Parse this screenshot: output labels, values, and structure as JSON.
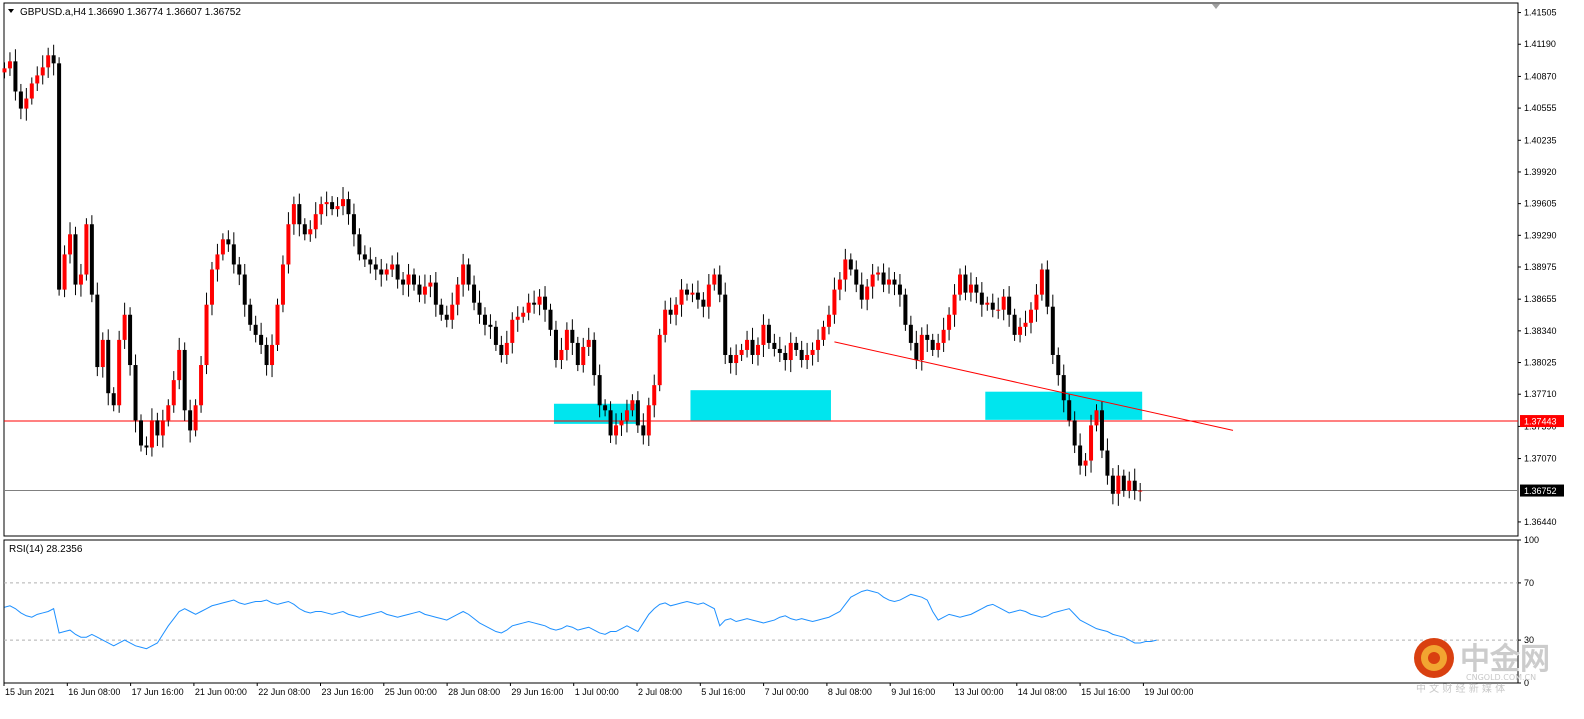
{
  "chart_header": {
    "symbol": "GBPUSD.a,H4",
    "ohlc": "1.36690 1.36774 1.36607 1.36752"
  },
  "chart_data": [
    {
      "type": "candlestick",
      "title": "GBPUSD.a,H4",
      "ylim": [
        1.363,
        1.416
      ],
      "price_ticks": [
        "1.41505",
        "1.41190",
        "1.40870",
        "1.40555",
        "1.40235",
        "1.39920",
        "1.39605",
        "1.39290",
        "1.38975",
        "1.38655",
        "1.38340",
        "1.38025",
        "1.37710",
        "1.37390",
        "1.37070",
        "1.36440"
      ],
      "x_ticks": [
        "15 Jun 2021",
        "16 Jun 08:00",
        "17 Jun 16:00",
        "21 Jun 00:00",
        "22 Jun 08:00",
        "23 Jun 16:00",
        "25 Jun 00:00",
        "28 Jun 08:00",
        "29 Jun 16:00",
        "1 Jul 00:00",
        "2 Jul 08:00",
        "5 Jul 16:00",
        "7 Jul 00:00",
        "8 Jul 08:00",
        "9 Jul 16:00",
        "13 Jul 00:00",
        "14 Jul 08:00",
        "15 Jul 16:00",
        "19 Jul 00:00"
      ],
      "candle_count": 220,
      "closes": [
        1.4095,
        1.4102,
        1.4072,
        1.4055,
        1.4065,
        1.408,
        1.4088,
        1.4096,
        1.4108,
        1.41,
        1.3875,
        1.391,
        1.393,
        1.388,
        1.389,
        1.394,
        1.387,
        1.3798,
        1.3825,
        1.3772,
        1.376,
        1.3825,
        1.385,
        1.38,
        1.3745,
        1.372,
        1.3718,
        1.3745,
        1.373,
        1.3745,
        1.376,
        1.3785,
        1.3815,
        1.3755,
        1.3735,
        1.376,
        1.38,
        1.386,
        1.3895,
        1.391,
        1.3925,
        1.392,
        1.39,
        1.389,
        1.386,
        1.384,
        1.383,
        1.382,
        1.38,
        1.382,
        1.386,
        1.39,
        1.394,
        1.396,
        1.394,
        1.393,
        1.3935,
        1.395,
        1.396,
        1.3962,
        1.3955,
        1.3958,
        1.3965,
        1.395,
        1.393,
        1.391,
        1.3905,
        1.39,
        1.3895,
        1.389,
        1.3895,
        1.39,
        1.3885,
        1.388,
        1.389,
        1.388,
        1.387,
        1.3878,
        1.3882,
        1.386,
        1.385,
        1.3845,
        1.386,
        1.388,
        1.39,
        1.388,
        1.3862,
        1.385,
        1.384,
        1.3838,
        1.382,
        1.381,
        1.3822,
        1.3845,
        1.3848,
        1.3852,
        1.3862,
        1.386,
        1.3868,
        1.3855,
        1.3835,
        1.3805,
        1.3815,
        1.3835,
        1.3822,
        1.38,
        1.3818,
        1.3825,
        1.379,
        1.376,
        1.3755,
        1.373,
        1.374,
        1.3745,
        1.3755,
        1.3765,
        1.374,
        1.373,
        1.376,
        1.378,
        1.383,
        1.3855,
        1.385,
        1.386,
        1.3875,
        1.387,
        1.3872,
        1.3865,
        1.3858,
        1.388,
        1.389,
        1.387,
        1.381,
        1.3802,
        1.381,
        1.3815,
        1.3825,
        1.381,
        1.382,
        1.384,
        1.3822,
        1.3816,
        1.3812,
        1.3805,
        1.3822,
        1.3815,
        1.3805,
        1.381,
        1.3815,
        1.3825,
        1.3838,
        1.385,
        1.3875,
        1.3885,
        1.3905,
        1.3895,
        1.388,
        1.3865,
        1.3878,
        1.389,
        1.3892,
        1.388,
        1.3885,
        1.388,
        1.387,
        1.384,
        1.3822,
        1.3805,
        1.383,
        1.3825,
        1.3815,
        1.3822,
        1.3835,
        1.385,
        1.387,
        1.389,
        1.3872,
        1.388,
        1.3872,
        1.386,
        1.3862,
        1.3855,
        1.3855,
        1.3868,
        1.385,
        1.383,
        1.3838,
        1.3842,
        1.3855,
        1.387,
        1.3895,
        1.3858,
        1.381,
        1.379,
        1.3765,
        1.3745,
        1.372,
        1.37,
        1.3705,
        1.374,
        1.3755,
        1.3715,
        1.369,
        1.3672,
        1.369,
        1.3675,
        1.3685,
        1.3675,
        1.36752
      ],
      "price_lines": [
        {
          "label": "1.37443",
          "value": 1.37443,
          "color": "#ff0000"
        },
        {
          "label": "1.36752",
          "value": 1.36752,
          "color": "#808080"
        }
      ],
      "support_zones": [
        {
          "from_candle": 101,
          "to_candle": 116,
          "low": 1.37415,
          "high": 1.37615,
          "color": "#00e5ee"
        },
        {
          "from_candle": 126,
          "to_candle": 151,
          "low": 1.3745,
          "high": 1.3775,
          "color": "#00e5ee"
        },
        {
          "from_candle": 180,
          "to_candle": 208,
          "low": 1.37455,
          "high": 1.37735,
          "color": "#00e5ee"
        }
      ],
      "trendline": {
        "from_candle": 152,
        "from_value": 1.3823,
        "to_candle": 225,
        "to_value": 1.3735,
        "color": "#ff0000"
      },
      "colors": {
        "bull": "#ff0000",
        "bear": "#000000",
        "wick": "#000000"
      }
    },
    {
      "type": "line",
      "title": "RSI(14) 28.2356",
      "ylim": [
        0,
        100
      ],
      "y_ticks": [
        "100",
        "70",
        "30",
        "0"
      ],
      "levels": [
        70,
        30
      ],
      "series": [
        {
          "name": "RSI(14)",
          "color": "#1e90ff",
          "values": [
            53,
            54,
            52,
            49,
            47,
            46,
            48,
            49,
            50,
            52,
            35,
            36,
            37,
            34,
            32,
            32,
            34,
            32,
            30,
            28,
            26,
            28,
            30,
            28,
            26,
            25,
            24,
            26,
            28,
            34,
            40,
            45,
            50,
            52,
            50,
            48,
            50,
            52,
            54,
            55,
            56,
            57,
            58,
            56,
            55,
            56,
            57,
            57,
            58,
            56,
            55,
            56,
            57,
            55,
            52,
            50,
            49,
            50,
            50,
            49,
            48,
            49,
            50,
            48,
            47,
            46,
            47,
            48,
            49,
            50,
            48,
            47,
            46,
            47,
            48,
            49,
            50,
            48,
            47,
            46,
            45,
            44,
            46,
            48,
            50,
            48,
            45,
            42,
            40,
            38,
            36,
            35,
            37,
            40,
            41,
            42,
            43,
            42,
            41,
            40,
            38,
            37,
            38,
            40,
            39,
            37,
            38,
            39,
            37,
            35,
            34,
            36,
            36,
            38,
            40,
            38,
            36,
            42,
            48,
            52,
            55,
            56,
            54,
            55,
            56,
            57,
            56,
            55,
            56,
            54,
            52,
            40,
            44,
            45,
            43,
            44,
            45,
            44,
            43,
            42,
            43,
            44,
            46,
            47,
            45,
            44,
            45,
            44,
            43,
            44,
            45,
            46,
            48,
            50,
            55,
            60,
            62,
            64,
            65,
            64,
            63,
            60,
            58,
            57,
            58,
            60,
            62,
            61,
            60,
            58,
            50,
            44,
            46,
            48,
            47,
            46,
            47,
            48,
            50,
            52,
            54,
            55,
            53,
            51,
            49,
            50,
            51,
            50,
            48,
            47,
            46,
            47,
            49,
            50,
            51,
            52,
            48,
            44,
            42,
            40,
            38,
            37,
            36,
            34,
            33,
            32,
            30,
            28,
            28,
            29,
            29,
            30
          ]
        }
      ]
    }
  ],
  "watermark": {
    "cn": "中金网",
    "domain": "CNGOLD.COM.CN",
    "slogan": "中 文 财 经 新 媒 体"
  }
}
